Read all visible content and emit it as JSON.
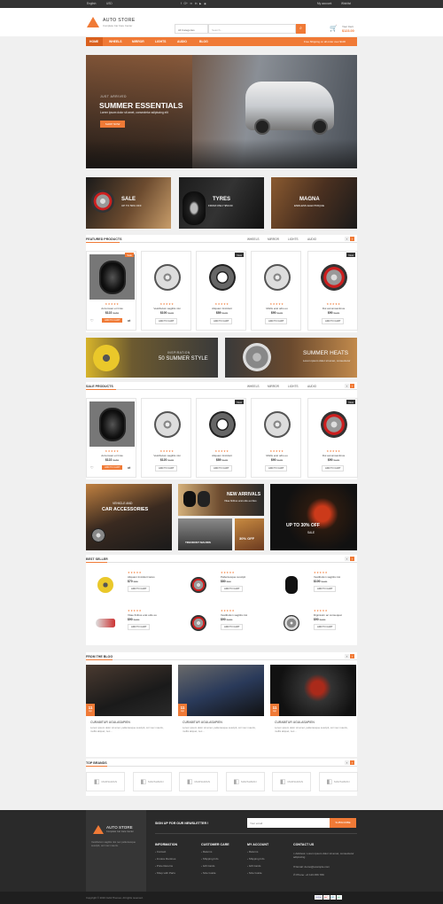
{
  "topbar": {
    "language": "English",
    "currency": "USD",
    "account": "My account",
    "wishlist": "Wishlist"
  },
  "header": {
    "store_name": "AUTO STORE",
    "tagline": "Complete Car Care Center",
    "category_select": "All Categories",
    "search_placeholder": "Search...",
    "cart_label": "Your Cart",
    "cart_total": "$123.00"
  },
  "nav": {
    "items": [
      "HOME",
      "WHEELS",
      "MIRROR",
      "LIGHTS",
      "AUDIO",
      "BLOG"
    ],
    "promo": "Free Shipping on all order over $100"
  },
  "hero": {
    "kicker": "JUST ARRIVED",
    "title": "SUMMER ESSENTIALS",
    "subtitle": "Lorem ipsum dolor sit amet, consectetur adipiscing elit",
    "button": "SHOP NOW"
  },
  "banners": [
    {
      "title": "SALE",
      "sub": "UP TO 50% OFF"
    },
    {
      "title": "TYRES",
      "sub": "FROM ONLY $50.00"
    },
    {
      "title": "MAGNA",
      "sub": "ENDLESS ELECTRIQUE"
    }
  ],
  "featured": {
    "title": "FEATURED PRODUCTS",
    "tabs": [
      "WHEELS",
      "MIRROR",
      "LIGHTS",
      "AUDIO"
    ],
    "products": [
      {
        "name": "Accumsan et Cras",
        "price": "$122",
        "old": "$150",
        "badge": "Sale",
        "img": "tire"
      },
      {
        "name": "Vestibulum sagittis nisi",
        "price": "$100",
        "old": "$120",
        "badge": "",
        "img": "wheel"
      },
      {
        "name": "Aliquam tincidunt",
        "price": "$89",
        "old": "$100",
        "badge": "New",
        "img": "chain"
      },
      {
        "name": "Mollis erat odio eu",
        "price": "$90",
        "old": "$100",
        "badge": "",
        "img": "wheel"
      },
      {
        "name": "Dui accumsantinus",
        "price": "$90",
        "old": "$100",
        "badge": "New",
        "img": "brake"
      }
    ],
    "add_to_cart": "ADD TO CART"
  },
  "mid_banners": [
    {
      "kicker": "INSPIRATION",
      "title": "50 SUMMER STYLE"
    },
    {
      "title": "SUMMER HEATS",
      "sub": "Lorem ipsum dolor sit amet, consectetur"
    }
  ],
  "sale": {
    "title": "SALE PRODUCTS",
    "tabs": [
      "WHEELS",
      "MIRROR",
      "LIGHTS",
      "AUDIO"
    ],
    "products": [
      {
        "name": "Accumsan et Cras",
        "price": "$122",
        "old": "$150",
        "badge": "",
        "img": "tire"
      },
      {
        "name": "Vestibulum sagittis nisi",
        "price": "$120",
        "old": "$130",
        "badge": "",
        "img": "wheel"
      },
      {
        "name": "Aliquam tincidunt",
        "price": "$89",
        "old": "$100",
        "badge": "New",
        "img": "chain"
      },
      {
        "name": "Mollis erat odio eu",
        "price": "$90",
        "old": "$100",
        "badge": "",
        "img": "wheel"
      },
      {
        "name": "Dui accumsantinus",
        "price": "$90",
        "old": "$100",
        "badge": "New",
        "img": "brake"
      }
    ]
  },
  "promo_blocks": [
    {
      "kicker": "VEHICLE AND",
      "title": "CAR ACCESSORIES"
    },
    {
      "title": "NEW ARRIVALS",
      "sub": "Vitae finibus erat odio eu litus"
    },
    {
      "title": "TINCIDUNT MAURIS"
    },
    {
      "title": "30% OFF"
    },
    {
      "title": "UP TO 30% OFF",
      "sub": "SALE"
    }
  ],
  "bestseller": {
    "title": "BEST SELLER",
    "items": [
      {
        "name": "Aliquam tincidunt lacus",
        "price": "$70",
        "old": "$80"
      },
      {
        "name": "Pellentesque suscipit",
        "price": "$80",
        "old": "$90"
      },
      {
        "name": "Vestibulum sagittis nisi",
        "price": "$100",
        "old": "$120"
      },
      {
        "name": "Vitae finibus erat odio eu",
        "price": "$90",
        "old": "$100"
      },
      {
        "name": "Vestibulum sagittis nisi",
        "price": "$90",
        "old": "$100"
      },
      {
        "name": "Dignissim ac consequat",
        "price": "$90",
        "old": "$100"
      }
    ]
  },
  "blog": {
    "title": "FROM THE BLOG",
    "posts": [
      {
        "day": "11",
        "month": "Apr",
        "title": "CURABITUR UGULASAPIEN",
        "text": "Lorem ipsum dolor sit amet, pellentesque suscipit, orci nec mauris, mollis aliquet, nec..."
      },
      {
        "day": "11",
        "month": "Apr",
        "title": "CURABITUR UGULASAPIEN",
        "text": "Lorem ipsum dolor sit amet, pellentesque suscipit, orci nec mauris, mollis aliquet, nec..."
      },
      {
        "day": "11",
        "month": "Apr",
        "title": "CURABITUR UGULASAPIEN",
        "text": "Lorem ipsum dolor sit amet, pellentesque suscipit, orci nec mauris, mollis aliquet, nec..."
      }
    ]
  },
  "brands": {
    "title": "TOP BRANDS",
    "name": "MARSHMAN"
  },
  "footer": {
    "newsletter": "SIGN UP FOR OUR NEWSLETTER !",
    "email_placeholder": "Your email",
    "subscribe": "SUBSCRIBE",
    "about": "Vestibulum sagittis nisi nec pellentesque suscipit, orci nec mauris.",
    "cols": [
      {
        "head": "INFORMATION",
        "links": [
          "Contact",
          "Invoice Rentnes",
          "Price Returns",
          "Shop with Parts"
        ]
      },
      {
        "head": "CUSTOMER CARE",
        "links": [
          "Returns",
          "Shipping Info",
          "Gift Cards",
          "Size Guide"
        ]
      },
      {
        "head": "MY ACCOUNT",
        "links": [
          "Returns",
          "Shipping Info",
          "Gift Cards",
          "Size Guide"
        ]
      }
    ],
    "contact_head": "CONTACT US",
    "address": "Address: Lorem ipsum dolor sit amet, consectetur adipiscing",
    "email": "Email: demo@example.com",
    "phone": "Phone: +0 123 456 789",
    "copyright": "Copyright © 2016 Cubit Themes. All rights reserved."
  }
}
